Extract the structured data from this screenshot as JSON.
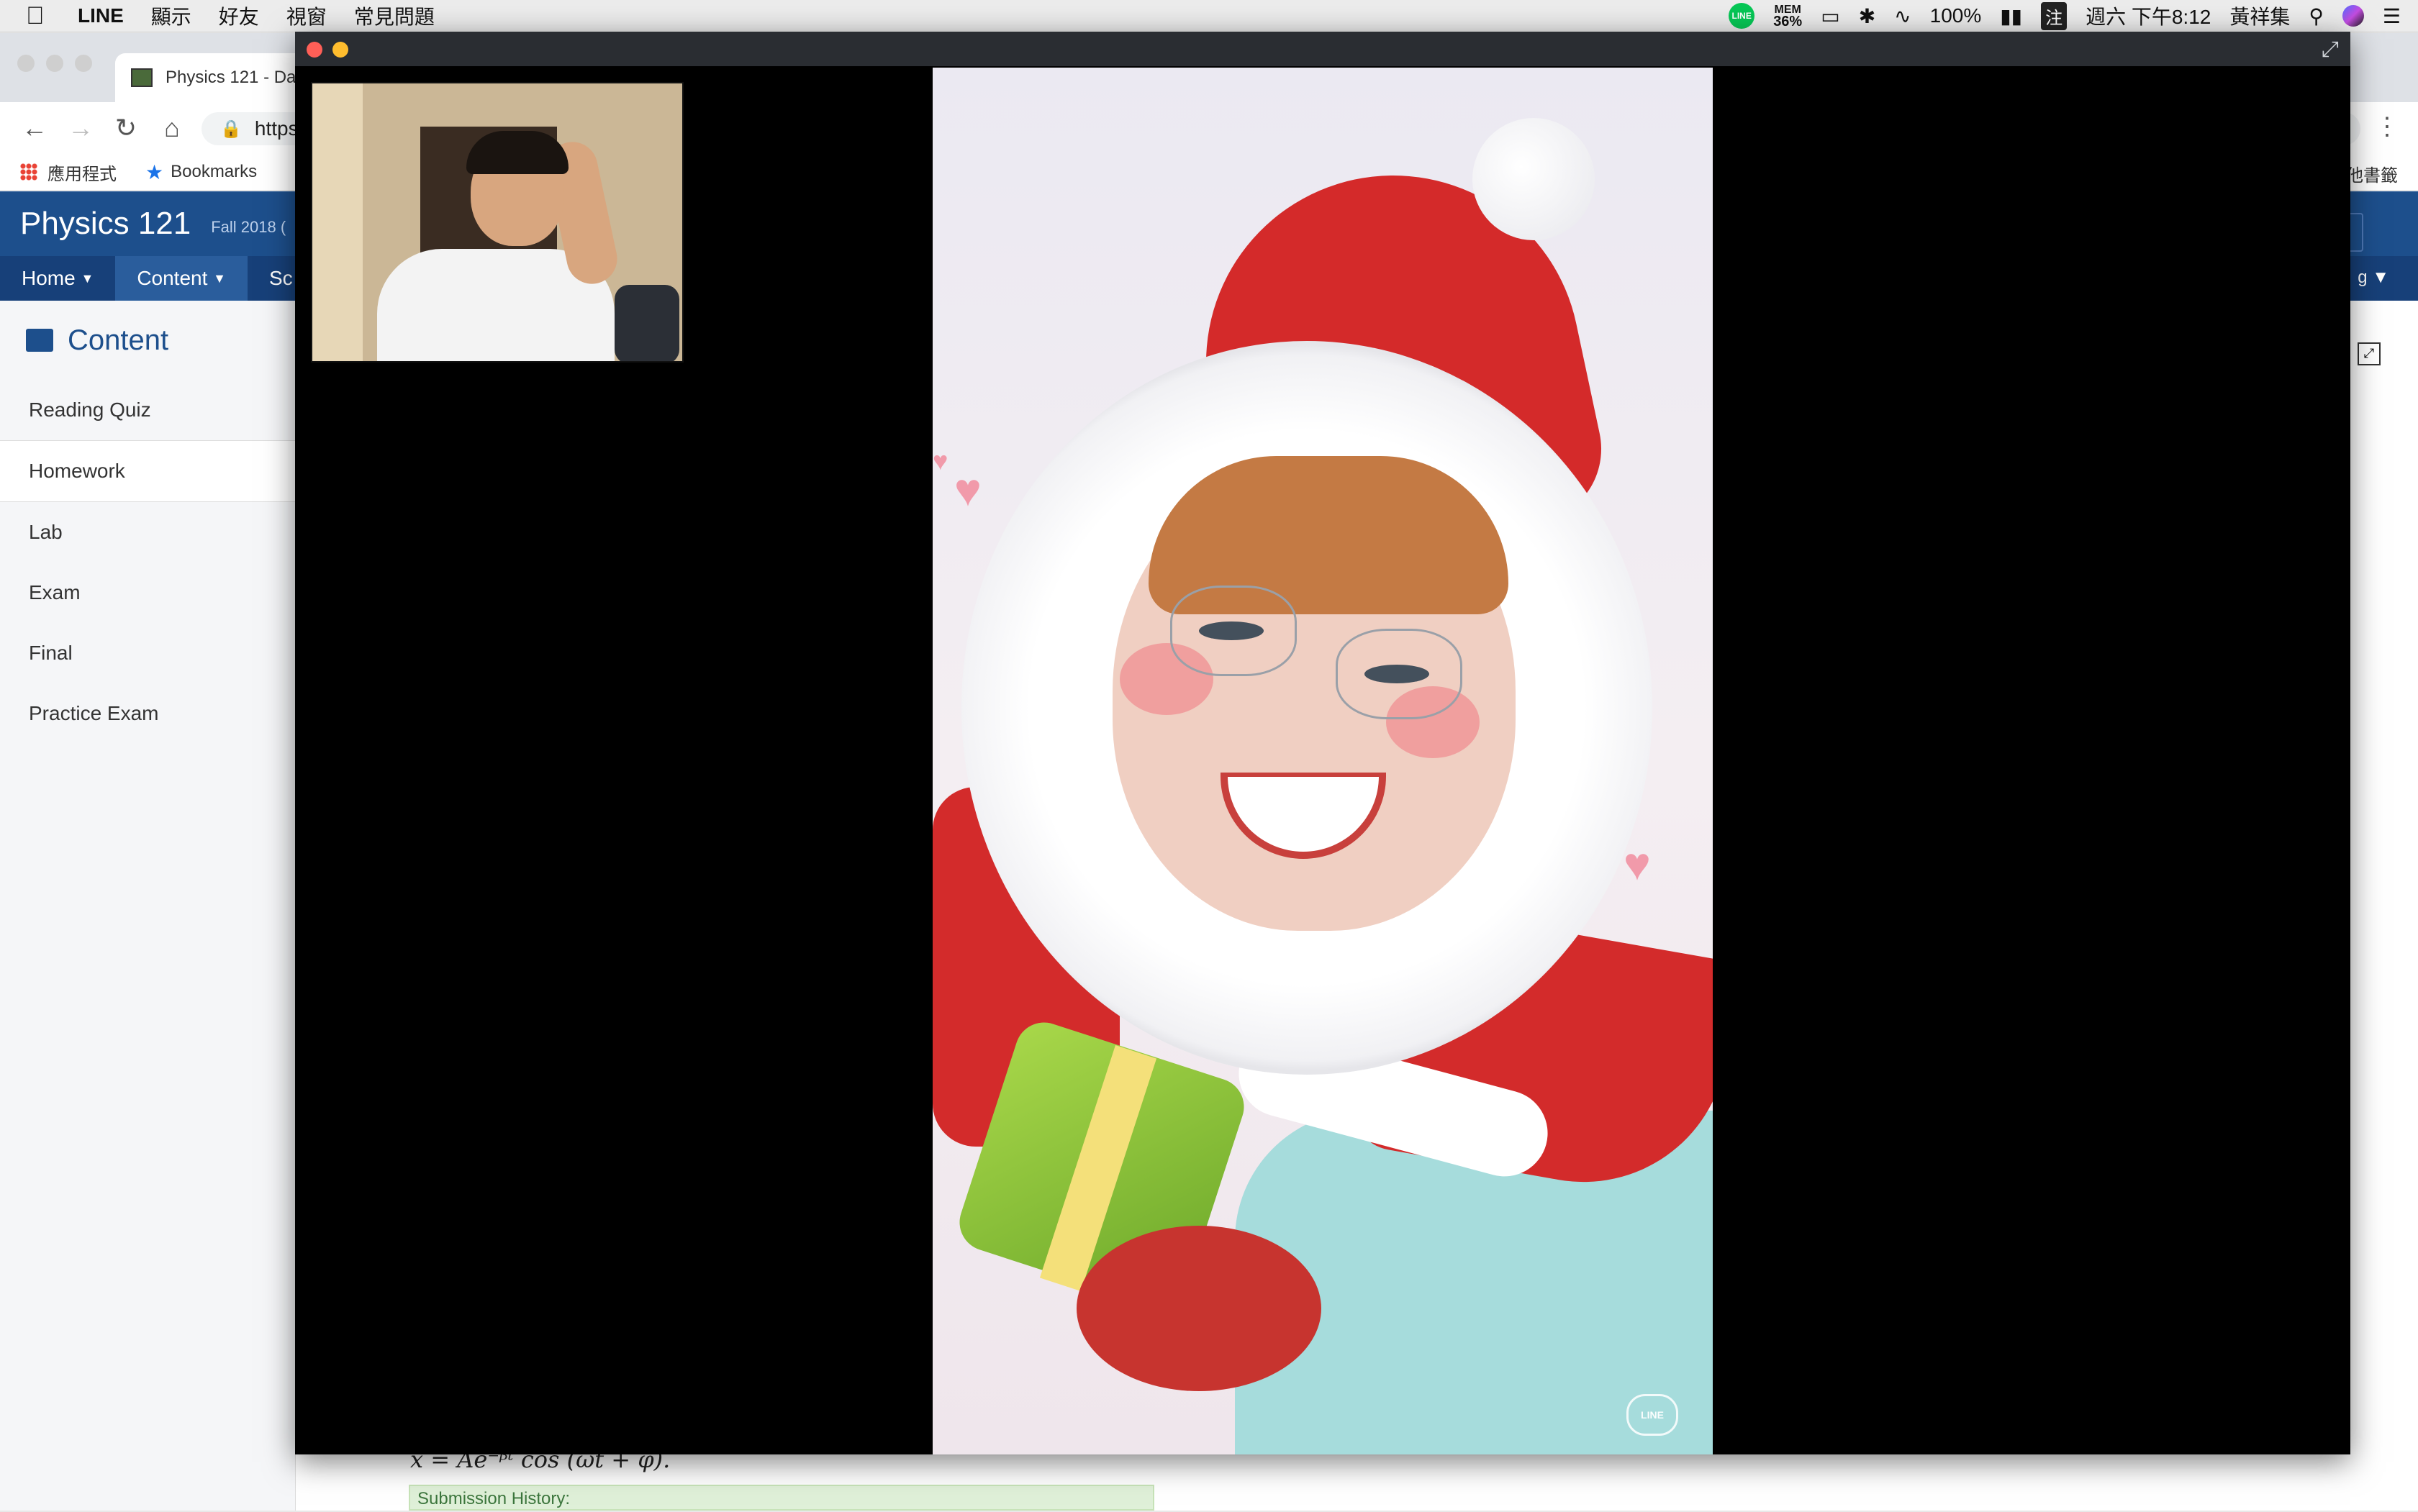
{
  "menubar": {
    "app_name": "LINE",
    "items": [
      "顯示",
      "好友",
      "視窗",
      "常見問題"
    ],
    "status": {
      "line_badge": "LINE",
      "mem_label": "MEM",
      "mem_value": "36%",
      "battery": "100%",
      "input_method": "注",
      "datetime": "週六 下午8:12",
      "user": "黃祥集"
    }
  },
  "browser": {
    "tab_title": "Physics 121 - Da",
    "url": "https",
    "bookmarks": {
      "apps_label": "應用程式",
      "bookmarks_label": "Bookmarks",
      "other": "他書籤"
    }
  },
  "course": {
    "title": "Physics 121",
    "term": "Fall 2018 (",
    "nav": [
      "Home",
      "Content",
      "Sc"
    ],
    "nav_right": "g"
  },
  "sidebar": {
    "heading": "Content",
    "items": [
      "Reading Quiz",
      "Homework",
      "Lab",
      "Exam",
      "Final",
      "Practice Exam"
    ],
    "active_index": 1
  },
  "main": {
    "formula": "x = Ae⁻ᵝᵗ cos (ωt + φ).",
    "submission_history": "Submission History:"
  },
  "call": {
    "watermark": "LINE"
  },
  "icons": {
    "apple": "apple-icon",
    "bluetooth": "bluetooth-icon",
    "wifi": "wifi-icon",
    "search": "search-icon",
    "fullscreen": "fullscreen-icon"
  },
  "colors": {
    "course_blue": "#1d4f8c",
    "close": "#ff5f57",
    "minimize": "#ffbd2e",
    "line_green": "#06c755"
  }
}
